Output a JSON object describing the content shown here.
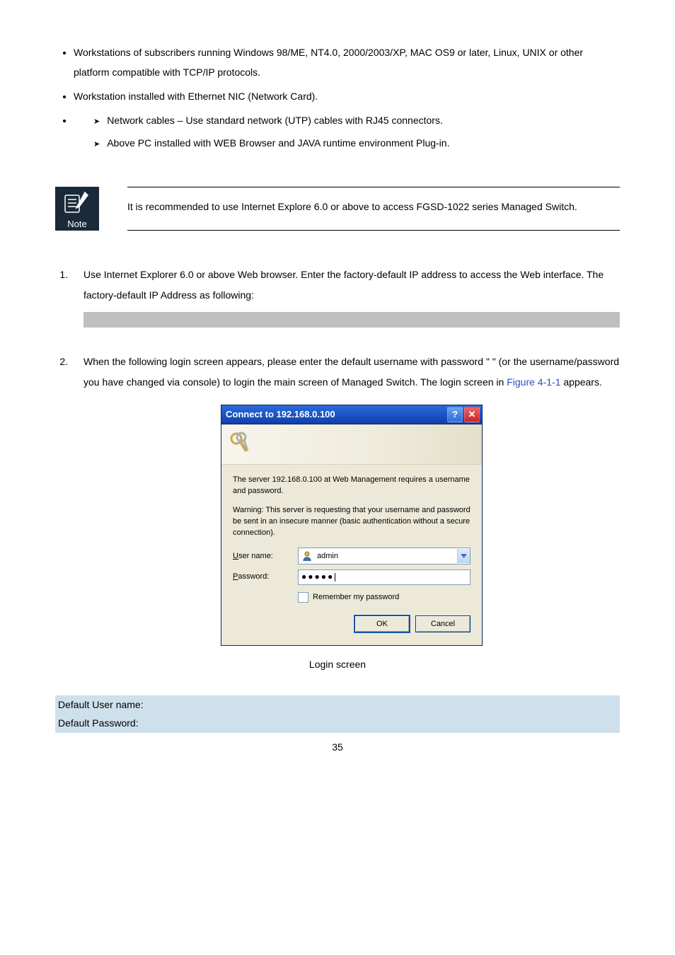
{
  "requirements": {
    "items": [
      "Workstations of subscribers running Windows 98/ME, NT4.0, 2000/2003/XP, MAC OS9 or later, Linux, UNIX or other platform compatible with TCP/IP protocols.",
      "Workstation installed with Ethernet NIC (Network Card)."
    ],
    "sub_items": [
      "Network cables – Use standard network (UTP) cables with RJ45 connectors.",
      "Above PC installed with WEB Browser and JAVA runtime environment Plug-in."
    ]
  },
  "note": {
    "label": "Note",
    "text": "It is recommended to use Internet Explore 6.0 or above to access FGSD-1022 series Managed Switch."
  },
  "steps": {
    "s1_a": "Use Internet Explorer 6.0 or above Web browser. Enter the factory-default IP address to access the Web interface. The factory-default IP Address as following:",
    "s2_a": "When the following login screen appears, please enter the default username ",
    "s2_b": " with password \" ",
    "s2_c": " \" (or the username/password you have changed via console) to login the main screen of Managed Switch. The login screen in ",
    "s2_figref": "Figure 4-1-1",
    "s2_d": " appears."
  },
  "dialog": {
    "title": "Connect to 192.168.0.100",
    "msg1": "The server 192.168.0.100 at Web Management requires a username and password.",
    "msg2": "Warning: This server is requesting that your username and password be sent in an insecure manner (basic authentication without a secure connection).",
    "user_label_pre": "U",
    "user_label_rest": "ser name:",
    "pass_label_pre": "P",
    "pass_label_rest": "assword:",
    "user_value": "admin",
    "pass_value": "●●●●●",
    "remember_pre": "R",
    "remember_rest": "emember my password",
    "ok": "OK",
    "cancel": "Cancel"
  },
  "caption": "Login screen",
  "credentials": {
    "user_label": "Default User name: ",
    "pass_label": "Default Password: "
  },
  "page_number": "35"
}
